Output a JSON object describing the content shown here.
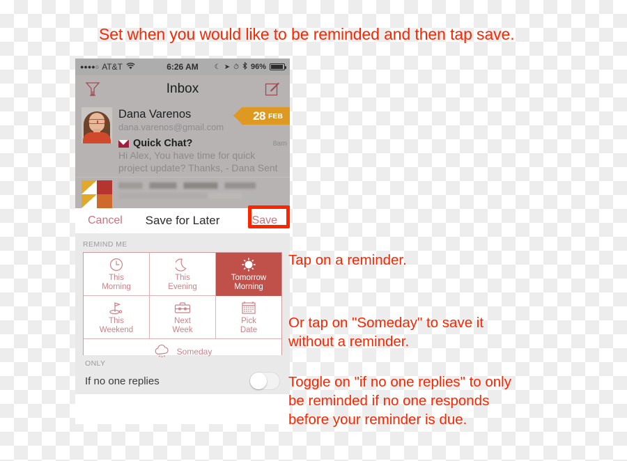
{
  "caption": {
    "top": "Set when you would like to be reminded and then tap save."
  },
  "phone": {
    "status_bar": {
      "signal_dots": "●●●●○",
      "carrier": "AT&T",
      "wifi_icon": "wifi-icon",
      "time": "6:26 AM",
      "moon_icon": "☾",
      "location_icon": "➤",
      "alarm_icon": "⏱",
      "bluetooth_icon": "bluetooth-icon",
      "battery_percent": "96%"
    },
    "nav": {
      "filter_icon": "funnel-filter-icon",
      "title": "Inbox",
      "compose_icon": "compose-pencil-icon"
    },
    "mail": {
      "sender": "Dana Varenos",
      "email": "dana.varenos@gmail.com",
      "date_day": "28",
      "date_month": "FEB",
      "envelope_icon": "envelope-icon",
      "subject": "Quick Chat?",
      "time": "8am",
      "preview": "Hi Alex, You have time for quick project update? Thanks, - Dana  Sent"
    },
    "action_bar": {
      "cancel": "Cancel",
      "title": "Save for Later",
      "save": "Save"
    },
    "remind": {
      "header": "REMIND ME",
      "tiles": [
        {
          "icon": "clock-icon",
          "line1": "This",
          "line2": "Morning",
          "selected": false
        },
        {
          "icon": "moon-icon",
          "line1": "This",
          "line2": "Evening",
          "selected": false
        },
        {
          "icon": "sun-icon",
          "line1": "Tomorrow",
          "line2": "Morning",
          "selected": true
        },
        {
          "icon": "golf-flag-icon",
          "line1": "This",
          "line2": "Weekend",
          "selected": false
        },
        {
          "icon": "briefcase-icon",
          "line1": "Next",
          "line2": "Week",
          "selected": false
        },
        {
          "icon": "calendar-icon",
          "line1": "Pick",
          "line2": "Date",
          "selected": false
        }
      ],
      "someday_icon": "cloud-icon",
      "someday": "Someday"
    },
    "only": {
      "header": "ONLY",
      "label": "If no one replies",
      "toggle_state": "off"
    }
  },
  "annotations": {
    "a1": "Tap on a reminder.",
    "a2": "Or tap on \"Someday\" to save it\nwithout a reminder.",
    "a3": "Toggle on \"if no one replies\" to only\nbe reminded if no one responds\nbefore your reminder is due."
  },
  "colors": {
    "annotation_red": "#fa2600",
    "selected_tile": "#c0504a",
    "tile_text": "#cc8186",
    "date_badge": "#dd9922"
  }
}
